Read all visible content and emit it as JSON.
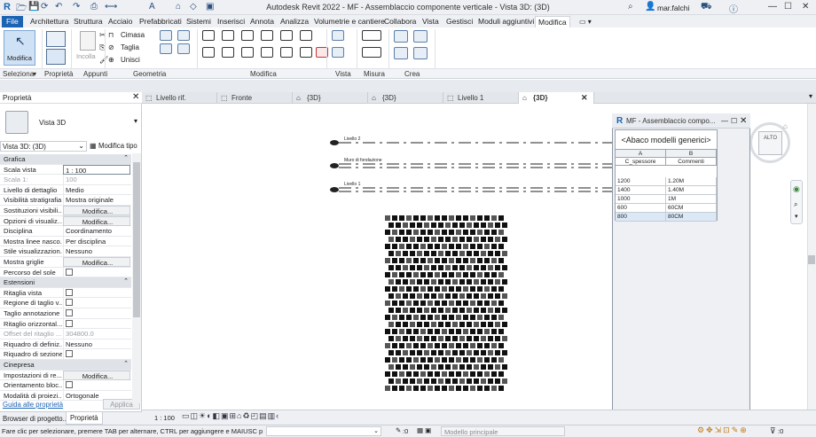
{
  "window": {
    "title": "Autodesk Revit 2022 - MF - Assemblaccio componente verticale - Vista 3D: (3D)",
    "user": "mar.falchi"
  },
  "menu_tabs": [
    "File",
    "Architettura",
    "Struttura",
    "Acciaio",
    "Prefabbricati",
    "Sistemi",
    "Inserisci",
    "Annota",
    "Analizza",
    "Volumetrie e cantiere",
    "Collabora",
    "Vista",
    "Gestisci",
    "Moduli aggiuntivi",
    "Modifica"
  ],
  "active_tab": "Modifica",
  "ribbon": {
    "modify_label": "Modifica",
    "paste_label": "Incolla",
    "geometry_buttons": [
      "Cimasa",
      "Taglia",
      "Unisci"
    ],
    "groups": [
      "Seleziona",
      "Proprietà",
      "Appunti",
      "Geometria",
      "Modifica",
      "Vista",
      "Misura",
      "Crea"
    ]
  },
  "properties": {
    "title": "Proprietà",
    "type_name": "Vista 3D",
    "view_selector": "Vista 3D: (3D)",
    "edit_type": "Modifica tipo",
    "groups": {
      "grafica": "Grafica",
      "estensioni": "Estensioni",
      "cinepresa": "Cinepresa"
    },
    "rows_grafica": [
      {
        "label": "Scala vista",
        "value": "1 : 100",
        "kind": "input"
      },
      {
        "label": "Scala 1:",
        "value": "100",
        "kind": "dim"
      },
      {
        "label": "Livello di dettaglio",
        "value": "Medio",
        "kind": "text"
      },
      {
        "label": "Visibilità stratigrafia",
        "value": "Mostra originale",
        "kind": "text"
      },
      {
        "label": "Sostituzioni visibili...",
        "value": "Modifica...",
        "kind": "btn"
      },
      {
        "label": "Opzioni di visualiz...",
        "value": "Modifica...",
        "kind": "btn"
      },
      {
        "label": "Disciplina",
        "value": "Coordinamento",
        "kind": "text"
      },
      {
        "label": "Mostra linee nasco...",
        "value": "Per disciplina",
        "kind": "text"
      },
      {
        "label": "Stile visualizzazion...",
        "value": "Nessuno",
        "kind": "text"
      },
      {
        "label": "Mostra griglie",
        "value": "Modifica...",
        "kind": "btn"
      },
      {
        "label": "Percorso del sole",
        "value": "",
        "kind": "check"
      }
    ],
    "rows_estensioni": [
      {
        "label": "Ritaglia vista",
        "value": "",
        "kind": "check"
      },
      {
        "label": "Regione di taglio v...",
        "value": "",
        "kind": "check"
      },
      {
        "label": "Taglio annotazione",
        "value": "",
        "kind": "check"
      },
      {
        "label": "Ritaglio orizzontal...",
        "value": "",
        "kind": "check"
      },
      {
        "label": "Offset del ritaglio ...",
        "value": "304800.0",
        "kind": "dim"
      },
      {
        "label": "Riquadro di definiz...",
        "value": "Nessuno",
        "kind": "text"
      },
      {
        "label": "Riquadro di sezione",
        "value": "",
        "kind": "check"
      }
    ],
    "rows_cinepresa": [
      {
        "label": "Impostazioni di re...",
        "value": "Modifica...",
        "kind": "btn"
      },
      {
        "label": "Orientamento bloc...",
        "value": "",
        "kind": "check"
      },
      {
        "label": "Modalità di proiezi...",
        "value": "Ortogonale",
        "kind": "text"
      }
    ],
    "help_link": "Guida alle proprietà",
    "apply": "Applica",
    "bottom_tabs": [
      "Browser di progetto...",
      "Proprietà"
    ]
  },
  "view_tabs": [
    "Livello rif.",
    "Fronte",
    "{3D}",
    "{3D}",
    "Livello 1",
    "{3D}"
  ],
  "view_tab_active": 5,
  "schedule": {
    "window_title": "MF - Assemblaccio compo...",
    "title": "<Abaco modelli generici>",
    "col_letters": [
      "A",
      "B"
    ],
    "col_headers": [
      "C_spessore",
      "Commenti"
    ],
    "rows": [
      [
        "1200",
        "1.20M"
      ],
      [
        "1400",
        "1.40M"
      ],
      [
        "1000",
        "1M"
      ],
      [
        "600",
        "60CM"
      ],
      [
        "800",
        "80CM"
      ]
    ]
  },
  "levels": [
    "Livello 2",
    "Muro di fondazione",
    "Livello 1"
  ],
  "view_cube": "ALTO",
  "bottom_view": {
    "scale": "1 : 100"
  },
  "statusbar": {
    "message": "Fare clic per selezionare, premere TAB per alternare, CTRL per aggiungere e MAIUSC per desel",
    "zero": ":0",
    "model": "Modello principale",
    "filter": ":0"
  }
}
